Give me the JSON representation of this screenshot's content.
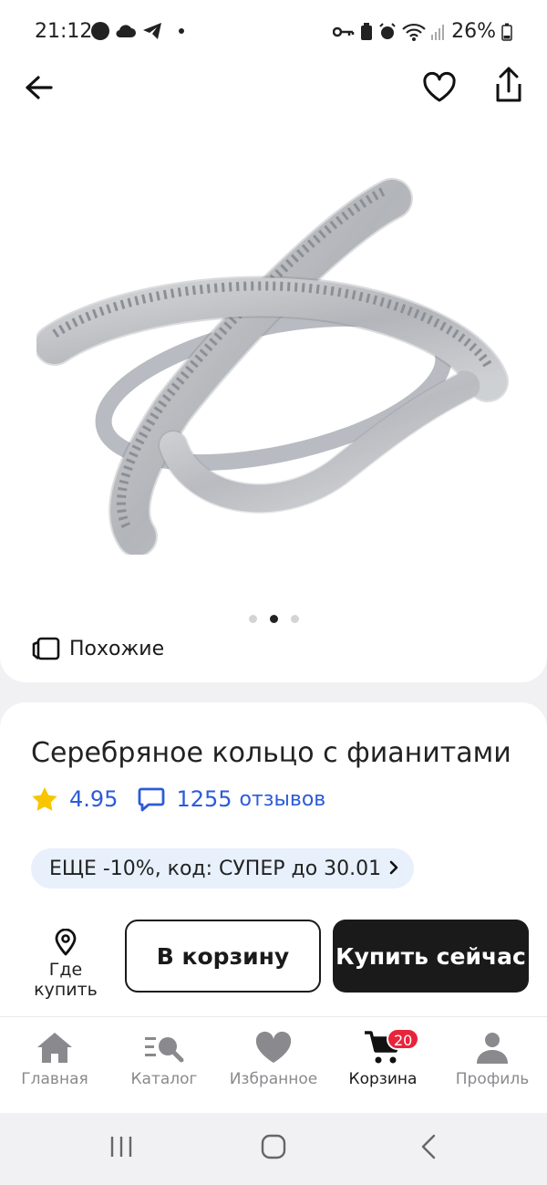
{
  "status_bar": {
    "time": "21:12",
    "battery": "26%"
  },
  "product": {
    "image_name": "silver ring with cubic zirconia",
    "gallery_dots": [
      false,
      true,
      false
    ],
    "similar_label": "Похожие",
    "title": "Серебряное кольцо с фианитами",
    "rating": "4.95",
    "reviews_count": "1255",
    "reviews_word": "отзывов",
    "promo": "ЕЩЕ -10%, код: СУПЕР до 30.01"
  },
  "actions": {
    "where_to_buy": "Где купить",
    "add_to_cart": "В корзину",
    "buy_now": "Купить сейчас"
  },
  "bottom_nav": {
    "tabs": [
      {
        "label": "Главная",
        "icon": "home-icon"
      },
      {
        "label": "Каталог",
        "icon": "catalog-search-icon"
      },
      {
        "label": "Избранное",
        "icon": "heart-icon"
      },
      {
        "label": "Корзина",
        "icon": "cart-icon",
        "badge": "20",
        "active": true
      },
      {
        "label": "Профиль",
        "icon": "profile-icon"
      }
    ]
  },
  "colors": {
    "accent_blue": "#2c5bd8",
    "badge_red": "#e8243b",
    "star_yellow": "#f7c600",
    "promo_bg": "#e8f0fc"
  }
}
